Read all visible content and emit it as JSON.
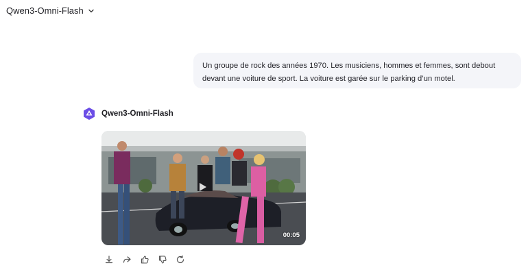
{
  "header": {
    "model_name": "Qwen3-Omni-Flash",
    "chevron_icon": "chevron-down-icon"
  },
  "user_message": {
    "text": "Un groupe de rock des années 1970. Les musiciens, hommes et femmes, sont debout devant une voiture de sport. La voiture est garée sur le parking d’un motel."
  },
  "assistant": {
    "name": "Qwen3-Omni-Flash",
    "logo_icon": "qwen-logo-icon",
    "video": {
      "duration": "00:05",
      "play_icon": "play-icon"
    },
    "actions": [
      {
        "icon": "download-icon"
      },
      {
        "icon": "share-icon"
      },
      {
        "icon": "thumbs-up-icon"
      },
      {
        "icon": "thumbs-down-icon"
      },
      {
        "icon": "regenerate-icon"
      }
    ]
  },
  "colors": {
    "bubble_bg": "#f4f5f9",
    "logo_purple": "#6b4de6",
    "text": "#1f1f24"
  }
}
